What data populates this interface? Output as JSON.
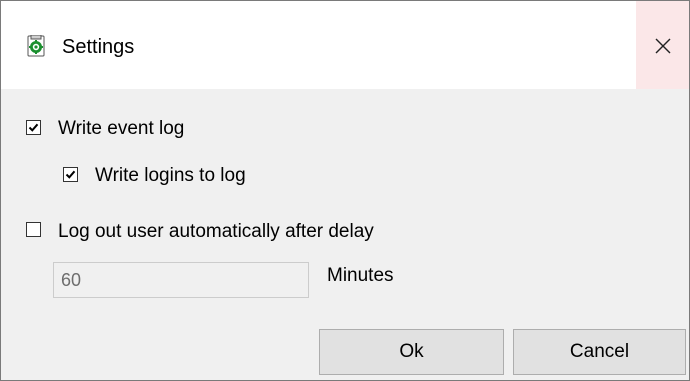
{
  "window": {
    "title": "Settings",
    "app_icon": "settings-app-icon",
    "close_icon": "close-icon"
  },
  "options": {
    "write_event_log": {
      "label": "Write event log",
      "checked": true
    },
    "write_logins": {
      "label": "Write logins to log",
      "checked": true
    },
    "auto_logout": {
      "label": "Log out user automatically after delay",
      "checked": false
    }
  },
  "delay": {
    "value": "60",
    "unit_label": "Minutes",
    "enabled": false
  },
  "buttons": {
    "ok_label": "Ok",
    "cancel_label": "Cancel"
  },
  "colors": {
    "close_hover_bg": "#fbe7e8",
    "icon_green": "#1a8f2e"
  }
}
